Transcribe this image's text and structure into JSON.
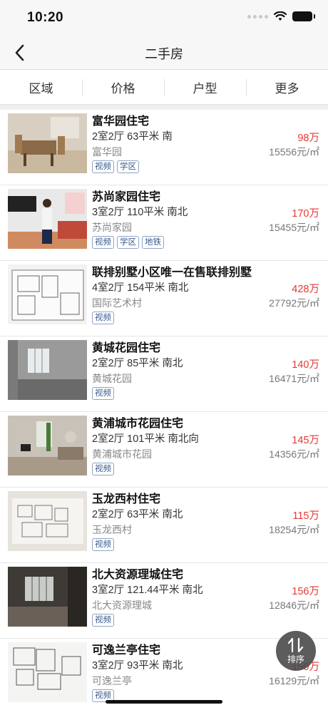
{
  "status_bar": {
    "time": "10:20"
  },
  "nav": {
    "title": "二手房"
  },
  "filters": [
    "区域",
    "价格",
    "户型",
    "更多"
  ],
  "listings": [
    {
      "title": "富华园住宅",
      "spec": "2室2厅 63平米 南",
      "area": "富华园",
      "price": "98万",
      "unit_price": "15556元/㎡",
      "tags": [
        "视频",
        "学区"
      ],
      "photo": "dining-room"
    },
    {
      "title": "苏尚家园住宅",
      "spec": "3室2厅 110平米 南北",
      "area": "苏尚家园",
      "price": "170万",
      "unit_price": "15455元/㎡",
      "tags": [
        "视频",
        "学区",
        "地铁"
      ],
      "photo": "living-room-person"
    },
    {
      "title": "联排别墅小区唯一在售联排别墅",
      "spec": "4室2厅 154平米 南北",
      "area": "国际艺术村",
      "price": "428万",
      "unit_price": "27792元/㎡",
      "tags": [
        "视频"
      ],
      "photo": "floor-plan"
    },
    {
      "title": "黄城花园住宅",
      "spec": "2室2厅 85平米 南北",
      "area": "黄城花园",
      "price": "140万",
      "unit_price": "16471元/㎡",
      "tags": [
        "视频"
      ],
      "photo": "empty-room"
    },
    {
      "title": "黄浦城市花园住宅",
      "spec": "2室2厅 101平米 南北向",
      "area": "黄浦城市花园",
      "price": "145万",
      "unit_price": "14356元/㎡",
      "tags": [
        "视频"
      ],
      "photo": "furnished-room"
    },
    {
      "title": "玉龙西村住宅",
      "spec": "2室2厅 63平米 南北",
      "area": "玉龙西村",
      "price": "115万",
      "unit_price": "18254元/㎡",
      "tags": [
        "视频"
      ],
      "photo": "floor-plan"
    },
    {
      "title": "北大资源理城住宅",
      "spec": "3室2厅 121.44平米 南北",
      "area": "北大资源理城",
      "price": "156万",
      "unit_price": "12846元/㎡",
      "tags": [
        "视频"
      ],
      "photo": "dark-room"
    },
    {
      "title": "可逸兰亭住宅",
      "spec": "3室2厅 93平米 南北",
      "area": "可逸兰亭",
      "price": "150万",
      "unit_price": "16129元/㎡",
      "tags": [
        "视频"
      ],
      "photo": "sketch-plan"
    }
  ],
  "sort_button": {
    "label": "排序",
    "icon": "sort-arrows-icon"
  },
  "colors": {
    "price": "#e53935",
    "tag_text": "#3a5a8c",
    "fab": "#464646"
  }
}
